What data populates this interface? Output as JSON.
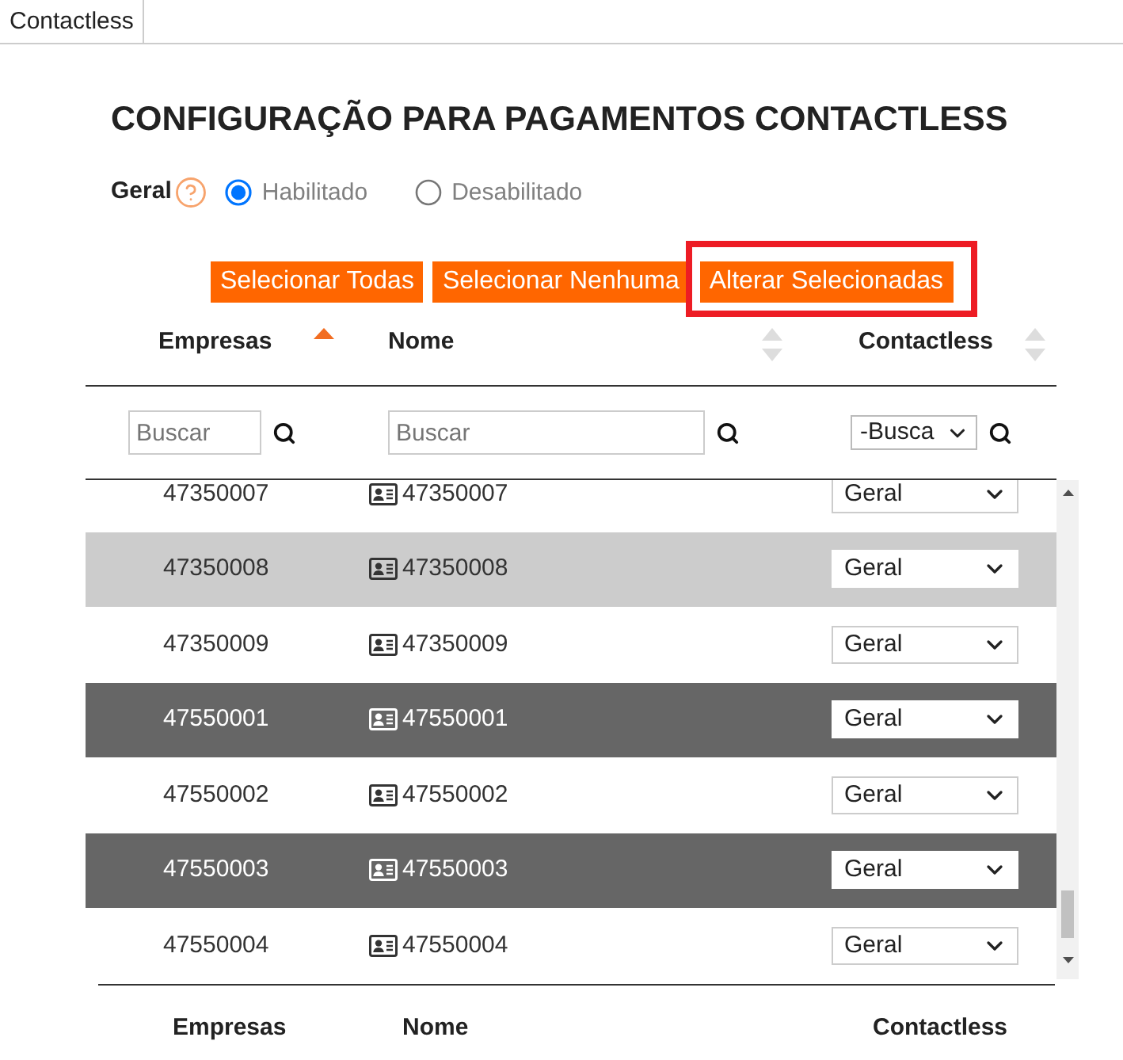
{
  "tab": {
    "label": "Contactless"
  },
  "title": "CONFIGURAÇÃO PARA PAGAMENTOS CONTACTLESS",
  "general": {
    "label": "Geral",
    "options": [
      {
        "label": "Habilitado",
        "selected": true
      },
      {
        "label": "Desabilitado",
        "selected": false
      }
    ]
  },
  "buttons": [
    {
      "label": "Selecionar Todas",
      "highlighted": false
    },
    {
      "label": "Selecionar Nenhuma",
      "highlighted": false
    },
    {
      "label": "Alterar Selecionadas",
      "highlighted": true
    }
  ],
  "table": {
    "columns": [
      {
        "label": "Empresas",
        "sorted": true
      },
      {
        "label": "Nome",
        "sorted": false
      },
      {
        "label": "Contactless",
        "sorted": false
      }
    ],
    "filters": [
      {
        "kind": "text",
        "placeholder": "Buscar"
      },
      {
        "kind": "text",
        "placeholder": "Buscar"
      },
      {
        "kind": "select",
        "value": "-Busca"
      }
    ],
    "rows": [
      {
        "empresa": "47350007",
        "nome": "47350007",
        "contactless": "Geral",
        "selected": false,
        "hovered": false
      },
      {
        "empresa": "47350008",
        "nome": "47350008",
        "contactless": "Geral",
        "selected": false,
        "hovered": true
      },
      {
        "empresa": "47350009",
        "nome": "47350009",
        "contactless": "Geral",
        "selected": false,
        "hovered": false
      },
      {
        "empresa": "47550001",
        "nome": "47550001",
        "contactless": "Geral",
        "selected": true,
        "hovered": false
      },
      {
        "empresa": "47550002",
        "nome": "47550002",
        "contactless": "Geral",
        "selected": false,
        "hovered": false
      },
      {
        "empresa": "47550003",
        "nome": "47550003",
        "contactless": "Geral",
        "selected": true,
        "hovered": false
      },
      {
        "empresa": "47550004",
        "nome": "47550004",
        "contactless": "Geral",
        "selected": false,
        "hovered": false
      }
    ],
    "footer_columns": [
      "Empresas",
      "Nome",
      "Contactless"
    ]
  }
}
